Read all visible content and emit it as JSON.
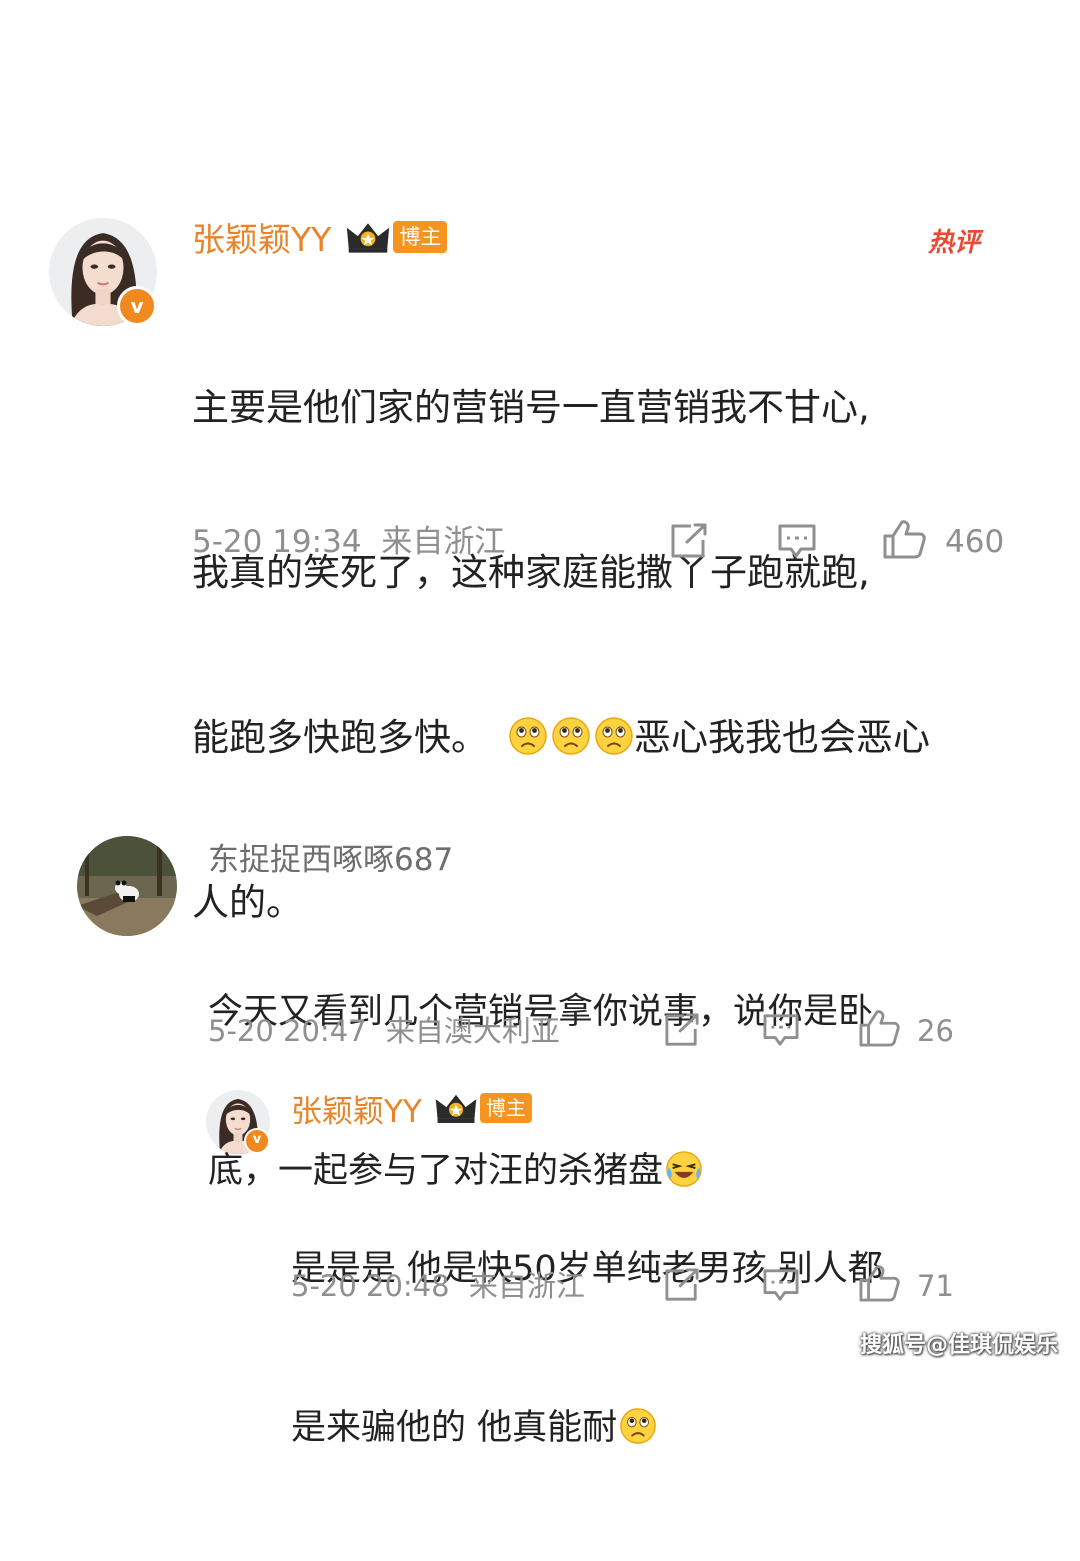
{
  "comment1": {
    "username": "张颖颖YY",
    "host_badge": "博主",
    "hot_tag": "热评",
    "lines": [
      "主要是他们家的营销号一直营销我不甘心,",
      "我真的笑死了，这种家庭能撒丫子跑就跑,",
      "能跑多快跑多快。",
      "恶心我我也会恶心",
      "人的。"
    ],
    "emoji": "sad-face-emoji",
    "date": "5-20 19:34",
    "location": "来自浙江",
    "likes": "460"
  },
  "comment2": {
    "username": "东捉捉西啄啄687",
    "lines": [
      "今天又看到几个营销号拿你说事，说你是卧",
      "底，一起参与了对汪的杀猪盘"
    ],
    "emoji": "laugh-cry-emoji",
    "date": "5-20 20:47",
    "location": "来自澳大利亚",
    "likes": "26"
  },
  "reply": {
    "username": "张颖颖YY",
    "host_badge": "博主",
    "lines": [
      "是是是 他是快50岁单纯老男孩 别人都",
      "是来骗他的 他真能耐"
    ],
    "emoji": "sad-face-emoji",
    "date": "5-20 20:48",
    "location": "来自浙江",
    "likes": "71"
  },
  "watermark": "搜狐号@佳琪侃娱乐",
  "colors": {
    "username_orange": "#e8852a",
    "badge_orange": "#f5951f",
    "hot_red": "#e84a32",
    "meta_gray": "#8f8f8f"
  }
}
